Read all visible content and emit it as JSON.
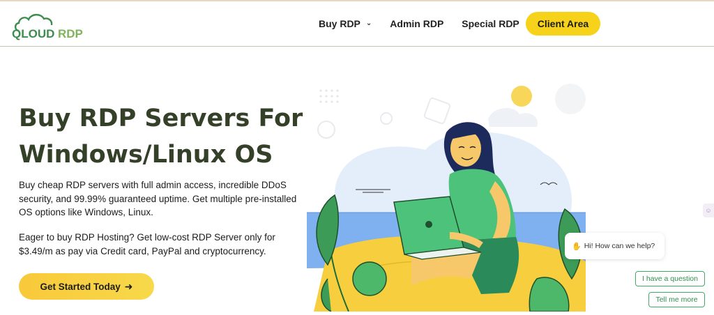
{
  "brand": {
    "logo_text_q": "QLOUD",
    "logo_text_rdp": "RDP",
    "colors": {
      "brand_green": "#3c8d4e",
      "accent_yellow": "#f7d21a",
      "heading": "#354028"
    }
  },
  "nav": {
    "items": [
      {
        "label": "Buy RDP",
        "has_dropdown": true
      },
      {
        "label": "Admin RDP",
        "has_dropdown": false
      },
      {
        "label": "Special RDP",
        "has_dropdown": true
      }
    ],
    "client_area": "Client Area",
    "chevron_icon": "chevron-down-icon"
  },
  "hero": {
    "title": "Buy RDP Servers For Windows/Linux OS",
    "para1": "Buy cheap RDP servers with full admin access, incredible DDoS security, and 99.99% guaranteed uptime. Get multiple pre-installed OS options like Windows, Linux.",
    "para2": "Eager to buy RDP Hosting? Get low-cost RDP Server only for $3.49/m as pay via Credit card, PayPal and cryptocurrency.",
    "cta_label": "Get Started Today",
    "cta_icon": "arrow-right-icon"
  },
  "chat": {
    "greeting": "Hi! How can we help?",
    "wave_icon": "waving-hand-icon",
    "options": [
      "I have a question",
      "Tell me more"
    ]
  }
}
